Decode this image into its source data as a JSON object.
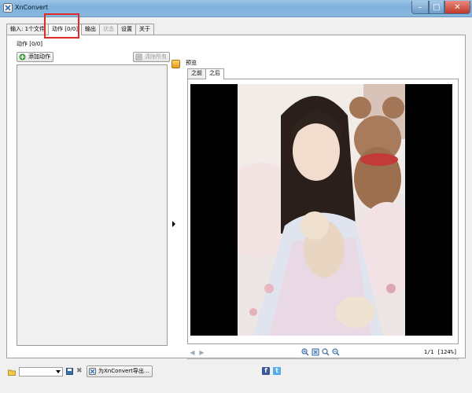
{
  "window": {
    "title": "XnConvert"
  },
  "tabs": [
    {
      "label": "输入: 1个文件",
      "state": "normal"
    },
    {
      "label": "动作 [0/0]",
      "state": "active"
    },
    {
      "label": "输出",
      "state": "normal"
    },
    {
      "label": "状态",
      "state": "disabled"
    },
    {
      "label": "设置",
      "state": "normal"
    },
    {
      "label": "关于",
      "state": "normal"
    }
  ],
  "actions": {
    "title": "动作 [0/0]",
    "add_label": "添加动作",
    "clear_label": "清除所有"
  },
  "preview": {
    "title": "预览",
    "tabs": [
      {
        "label": "之前",
        "state": "normal"
      },
      {
        "label": "之后",
        "state": "active"
      }
    ],
    "page_info": "1/1 [124%]"
  },
  "bottom": {
    "preset_value": "",
    "export_label": "为XnConvert导出..."
  },
  "icons": {
    "app": "xnconvert-logo-icon",
    "minimize": "minimize-icon",
    "maximize": "maximize-icon",
    "close": "close-icon",
    "add": "add-icon",
    "clear": "clear-icon",
    "preview_toggle": "preview-toggle-icon",
    "zoom_in": "zoom-in-icon",
    "zoom_fit": "zoom-fit-icon",
    "zoom_actual": "zoom-actual-icon",
    "zoom_out": "zoom-out-icon",
    "prev": "prev-arrow-icon",
    "next": "next-arrow-icon",
    "folder": "folder-icon",
    "save": "save-icon",
    "delete": "delete-icon",
    "facebook": "facebook-icon",
    "twitter": "twitter-icon"
  },
  "colors": {
    "highlight": "#e02a2a",
    "titlebar": "#86b8df",
    "close_button": "#c0392b"
  }
}
